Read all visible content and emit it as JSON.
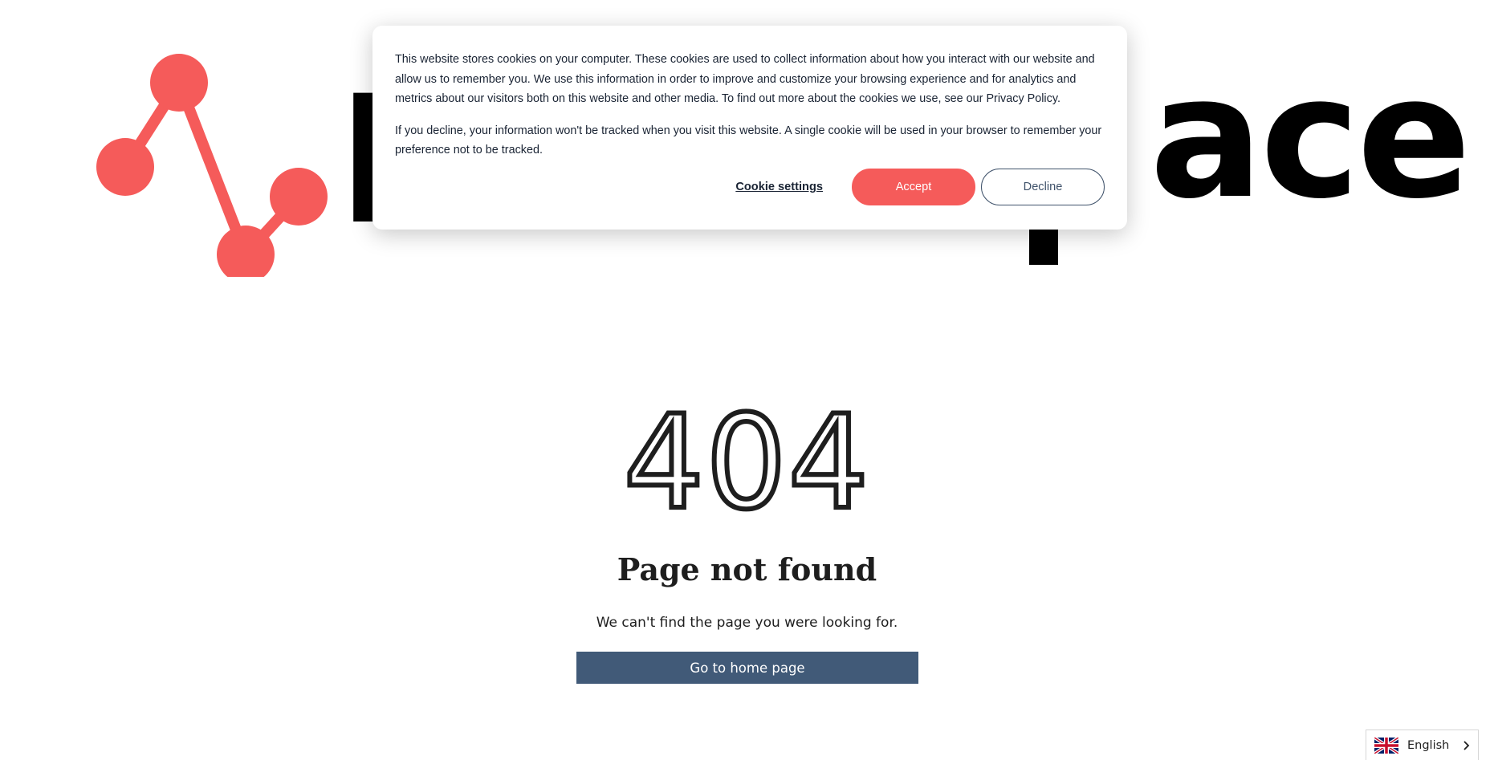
{
  "cookie_banner": {
    "paragraph_1": "This website stores cookies on your computer. These cookies are used to collect information about how you interact with our website and allow us to remember you. We use this information in order to improve and customize your browsing experience and for analytics and metrics about our visitors both on this website and other media. To find out more about the cookies we use, see our Privacy Policy.",
    "paragraph_2": "If you decline, your information won't be tracked when you visit this website. A single cookie will be used in your browser to remember your preference not to be tracked.",
    "settings_label": "Cookie settings",
    "accept_label": "Accept",
    "decline_label": "Decline"
  },
  "logo": {
    "icon": "network-nodes-icon",
    "word_left": "I",
    "word_right": "ace",
    "accent_color": "#f55b5a"
  },
  "error_page": {
    "code": "404",
    "title": "Page not found",
    "message": "We can't find the page you were looking for.",
    "home_button_label": "Go to home page"
  },
  "language_selector": {
    "selected": "English",
    "flag_icon": "uk-flag-icon",
    "chevron_icon": "chevron-right-icon"
  },
  "colors": {
    "accent": "#f55b5a",
    "primary_button": "#415a78",
    "text": "#1e1e1e"
  }
}
